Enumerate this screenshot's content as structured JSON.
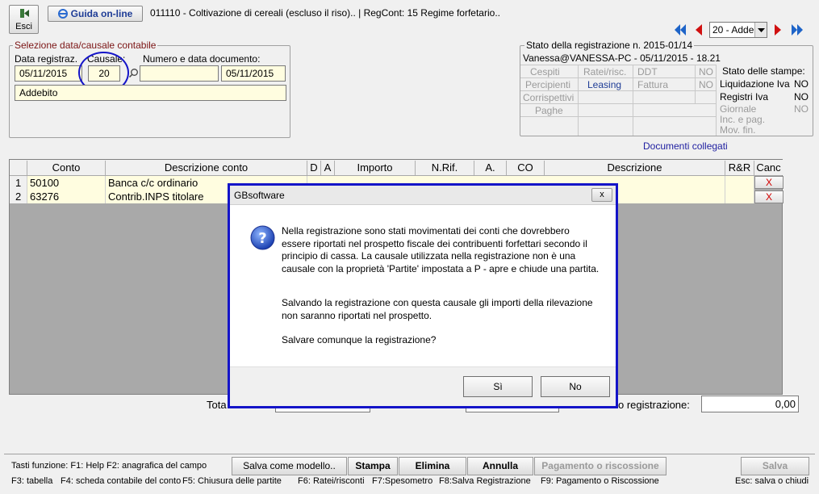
{
  "toolbar": {
    "exit_label": "Esci",
    "guide_label": "Guida on-line",
    "title_text": "011110 - Coltivazione di cereali (escluso il riso).. | RegCont: 15 Regime forfetario.."
  },
  "nav": {
    "causale_select_value": "20 - Adde"
  },
  "selection": {
    "legend": "Selezione data/causale contabile",
    "date_label": "Data registraz.",
    "causale_label": "Causale:",
    "doc_label": "Numero e data documento:",
    "date_value": "05/11/2015",
    "causale_value": "20",
    "doc_number_value": "",
    "doc_date_value": "05/11/2015",
    "causale_description": "Addebito"
  },
  "status": {
    "legend": "Stato della registrazione n. 2015-01/14",
    "user_line": "Vanessa@VANESSA-PC - 05/11/2015 - 18.21",
    "grid": {
      "cespiti": "Cespiti",
      "ratei": "Ratei/risc.",
      "ddt": "DDT",
      "ddt_val": "NO",
      "percipienti": "Percipienti",
      "leasing": "Leasing",
      "fattura": "Fattura",
      "fattura_val": "NO",
      "corrispettivi": "Corrispettivi",
      "paghe": "Paghe"
    },
    "prints_title": "Stato delle stampe:",
    "liq_iva": "Liquidazione Iva",
    "liq_iva_val": "NO",
    "reg_iva": "Registri Iva",
    "reg_iva_val": "NO",
    "giornale": "Giornale",
    "giornale_val": "NO",
    "inc_pag": "Inc. e pag.",
    "mov_fin": "Mov. fin."
  },
  "linked_docs_label": "Documenti collegati",
  "table": {
    "headers": {
      "conto": "Conto",
      "descr_conto": "Descrizione conto",
      "d": "D",
      "a": "A",
      "importo": "Importo",
      "nrif": "N.Rif.",
      "a2": "A.",
      "co": "CO",
      "descrizione": "Descrizione",
      "rr": "R&R",
      "canc": "Canc"
    },
    "rows": [
      {
        "num": "1",
        "conto": "50100",
        "descr": "Banca c/c ordinario",
        "cancel": "X"
      },
      {
        "num": "2",
        "conto": "63276",
        "descr": "Contrib.INPS titolare",
        "cancel": "X"
      }
    ]
  },
  "totals": {
    "total_label": "Tota",
    "reg_label": "o registrazione:",
    "reg_value": "0,00"
  },
  "dialog": {
    "title": "GBsoftware",
    "close": "x",
    "para1": "Nella registrazione sono stati movimentati dei conti che dovrebbero essere riportati nel prospetto fiscale dei contribuenti forfettari secondo il principio di cassa. La causale utilizzata nella registrazione non è una causale con la proprietà 'Partite' impostata a P - apre e chiude una partita.",
    "para2": "Salvando la registrazione con questa causale gli importi della rilevazione non saranno riportati nel prospetto.",
    "para3": "Salvare comunque la registrazione?",
    "yes_label": "Sì",
    "no_label": "No"
  },
  "bottom": {
    "fkeys_line1": "Tasti funzione: F1: Help  F2: anagrafica del campo",
    "save_model": "Salva come modello..",
    "print": "Stampa",
    "delete": "Elimina",
    "cancel": "Annulla",
    "payment": "Pagamento o riscossione",
    "save": "Salva",
    "f3": "F3: tabella",
    "f4": "F4: scheda contabile del conto",
    "f5": "F5: Chiusura delle partite",
    "f6": "F6: Ratei/risconti",
    "f7": "F7:Spesometro",
    "f8": "F8:Salva Registrazione",
    "f9": "F9: Pagamento o Riscossione",
    "esc": "Esc: salva o chiudi"
  },
  "colors": {
    "accent_blue": "#1414c8",
    "legend_red": "#7b1414",
    "field_yellow": "#fffde0",
    "nav_blue": "#1e64c8",
    "nav_red": "#d01010"
  }
}
